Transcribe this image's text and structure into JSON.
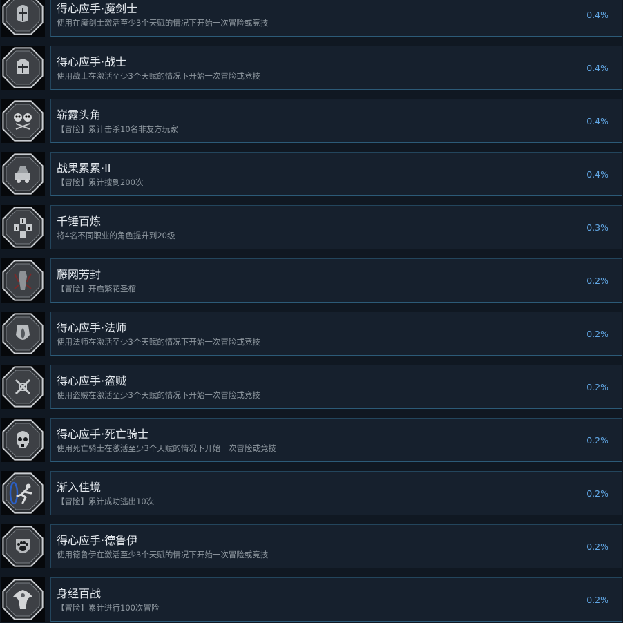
{
  "achievements": [
    {
      "title": "得心应手·魔剑士",
      "desc": "使用在魔剑士激活至少3个天赋的情况下开始一次冒险或竞技",
      "pct": "0.4%",
      "icon": "dark-knight-helmet-icon"
    },
    {
      "title": "得心应手·战士",
      "desc": "使用战士在激活至少3个天赋的情况下开始一次冒险或竞技",
      "pct": "0.4%",
      "icon": "fighter-helmet-icon"
    },
    {
      "title": "崭露头角",
      "desc": "【冒险】累计击杀10名非友方玩家",
      "pct": "0.4%",
      "icon": "skulls-swords-icon"
    },
    {
      "title": "战果累累·II",
      "desc": "【冒险】累计搜到200次",
      "pct": "0.4%",
      "icon": "treasure-cart-icon"
    },
    {
      "title": "千锤百炼",
      "desc": "将4名不同职业的角色提升到20级",
      "pct": "0.3%",
      "icon": "four-class-emblems-icon"
    },
    {
      "title": "藤网芳封",
      "desc": "【冒险】开启繁花圣棺",
      "pct": "0.2%",
      "icon": "thorned-coffin-icon"
    },
    {
      "title": "得心应手·法师",
      "desc": "使用法师在激活至少3个天赋的情况下开始一次冒险或竞技",
      "pct": "0.2%",
      "icon": "wizard-flame-icon"
    },
    {
      "title": "得心应手·盗贼",
      "desc": "使用盗贼在激活至少3个天赋的情况下开始一次冒险或竞技",
      "pct": "0.2%",
      "icon": "crossed-daggers-icon"
    },
    {
      "title": "得心应手·死亡骑士",
      "desc": "使用死亡骑士在激活至少3个天赋的情况下开始一次冒险或竞技",
      "pct": "0.2%",
      "icon": "death-knight-skull-icon"
    },
    {
      "title": "渐入佳境",
      "desc": "【冒险】累计成功逃出10次",
      "pct": "0.2%",
      "icon": "escape-portal-icon"
    },
    {
      "title": "得心应手·德鲁伊",
      "desc": "使用德鲁伊在激活至少3个天赋的情况下开始一次冒险或竞技",
      "pct": "0.2%",
      "icon": "druid-paw-icon"
    },
    {
      "title": "身经百战",
      "desc": "【冒险】累计进行100次冒险",
      "pct": "0.2%",
      "icon": "phoenix-warrior-icon"
    }
  ]
}
